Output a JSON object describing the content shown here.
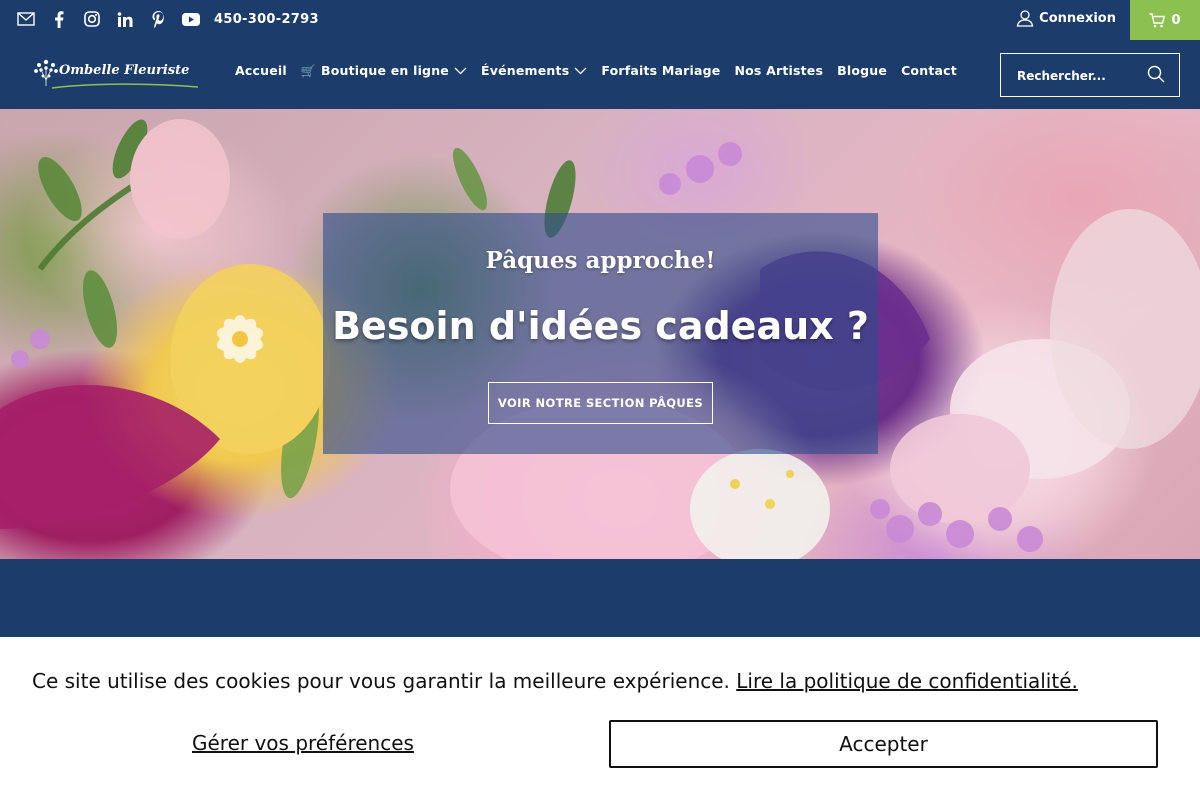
{
  "topbar": {
    "social_icons": [
      "email-icon",
      "facebook-icon",
      "instagram-icon",
      "linkedin-icon",
      "pinterest-icon",
      "youtube-icon"
    ],
    "phone": "450-300-2793",
    "login_label": "Connexion",
    "cart_count": "0",
    "colors": {
      "bar": "#1c3c6b",
      "cart": "#8cc152"
    }
  },
  "header": {
    "logo_text": "Ombelle Fleuriste",
    "nav": {
      "home": "Accueil",
      "shop": "Boutique en ligne",
      "shop_icon": "🛒",
      "events": "Événements",
      "wedding": "Forfaits Mariage",
      "artists": "Nos Artistes",
      "blog": "Blogue",
      "contact": "Contact"
    },
    "search_placeholder": "Rechercher..."
  },
  "hero": {
    "kicker": "Pâques approche!",
    "title": "Besoin d'idées cadeaux ?",
    "button": "VOIR NOTRE SECTION PÂQUES"
  },
  "cookie": {
    "message": "Ce site utilise des cookies pour vous garantir la meilleure expérience.",
    "policy_link": "Lire la politique de confidentialité.",
    "preferences": "Gérer vos préférences",
    "accept": "Accepter"
  }
}
